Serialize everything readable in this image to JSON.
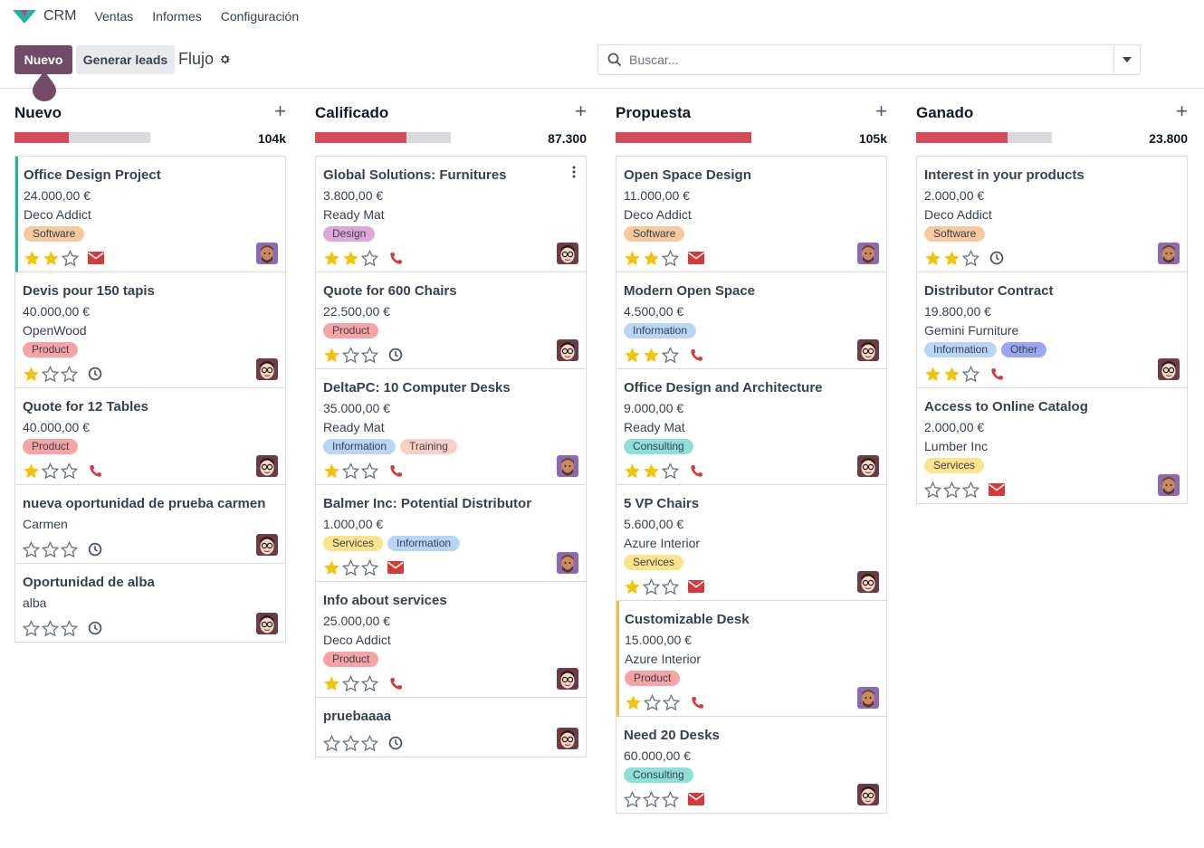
{
  "navbar": {
    "app_name": "CRM",
    "menu": [
      "Ventas",
      "Informes",
      "Configuración"
    ]
  },
  "control": {
    "new_label": "Nuevo",
    "generate_label": "Generar leads",
    "breadcrumb": "Flujo",
    "search_placeholder": "Buscar..."
  },
  "colors": {
    "primary": "#714b67",
    "progress_red": "#d44c59",
    "star_gold": "#f3c30b",
    "email_red": "#d43a3a"
  },
  "columns": [
    {
      "title": "Nuevo",
      "total": "104k",
      "progress": 0.4,
      "cards": [
        {
          "title": "Office Design Project",
          "amount": "24.000,00 €",
          "partner": "Deco Addict",
          "tags": [
            "Software"
          ],
          "stars": 2,
          "activity": "email-icon",
          "avatar": "avatar-brown",
          "accent": "green"
        },
        {
          "title": "Devis pour 150 tapis",
          "amount": "40.000,00 €",
          "partner": "OpenWood",
          "tags": [
            "Product"
          ],
          "stars": 1,
          "activity": "clock-icon",
          "avatar": "avatar-glasses"
        },
        {
          "title": "Quote for 12 Tables",
          "amount": "40.000,00 €",
          "partner": "",
          "tags": [
            "Product"
          ],
          "stars": 1,
          "activity": "phone-icon",
          "avatar": "avatar-glasses"
        },
        {
          "title": "nueva oportunidad de prueba carmen",
          "amount": "",
          "partner": "Carmen",
          "tags": [],
          "stars": 0,
          "activity": "clock-icon",
          "avatar": "avatar-glasses"
        },
        {
          "title": "Oportunidad de alba",
          "amount": "",
          "partner": "alba",
          "tags": [],
          "stars": 0,
          "activity": "clock-icon",
          "avatar": "avatar-glasses"
        }
      ]
    },
    {
      "title": "Calificado",
      "total": "87.300",
      "progress": 0.67,
      "cards": [
        {
          "title": "Global Solutions: Furnitures",
          "amount": "3.800,00 €",
          "partner": "Ready Mat",
          "tags": [
            "Design"
          ],
          "stars": 2,
          "activity": "phone-icon",
          "avatar": "avatar-glasses",
          "kebab": true
        },
        {
          "title": "Quote for 600 Chairs",
          "amount": "22.500,00 €",
          "partner": "",
          "tags": [
            "Product"
          ],
          "stars": 1,
          "activity": "clock-icon",
          "avatar": "avatar-glasses"
        },
        {
          "title": "DeltaPC: 10 Computer Desks",
          "amount": "35.000,00 €",
          "partner": "Ready Mat",
          "tags": [
            "Information",
            "Training"
          ],
          "stars": 1,
          "activity": "phone-icon",
          "avatar": "avatar-brown"
        },
        {
          "title": "Balmer Inc: Potential Distributor",
          "amount": "1.000,00 €",
          "partner": "",
          "tags": [
            "Services",
            "Information"
          ],
          "stars": 1,
          "activity": "email-icon",
          "avatar": "avatar-brown"
        },
        {
          "title": "Info about services",
          "amount": "25.000,00 €",
          "partner": "Deco Addict",
          "tags": [
            "Product"
          ],
          "stars": 1,
          "activity": "phone-icon",
          "avatar": "avatar-glasses"
        },
        {
          "title": "pruebaaaa",
          "amount": "",
          "partner": "",
          "tags": [],
          "stars": 0,
          "activity": "clock-icon",
          "avatar": "avatar-glasses"
        }
      ]
    },
    {
      "title": "Propuesta",
      "total": "105k",
      "progress": 1.0,
      "cards": [
        {
          "title": "Open Space Design",
          "amount": "11.000,00 €",
          "partner": "Deco Addict",
          "tags": [
            "Software"
          ],
          "stars": 2,
          "activity": "email-icon",
          "avatar": "avatar-brown"
        },
        {
          "title": "Modern Open Space",
          "amount": "4.500,00 €",
          "partner": "",
          "tags": [
            "Information"
          ],
          "stars": 2,
          "activity": "phone-icon",
          "avatar": "avatar-glasses"
        },
        {
          "title": "Office Design and Architecture",
          "amount": "9.000,00 €",
          "partner": "Ready Mat",
          "tags": [
            "Consulting"
          ],
          "stars": 2,
          "activity": "phone-icon",
          "avatar": "avatar-glasses"
        },
        {
          "title": "5 VP Chairs",
          "amount": "5.600,00 €",
          "partner": "Azure Interior",
          "tags": [
            "Services"
          ],
          "stars": 1,
          "activity": "email-icon",
          "avatar": "avatar-glasses"
        },
        {
          "title": "Customizable Desk",
          "amount": "15.000,00 €",
          "partner": "Azure Interior",
          "tags": [
            "Product"
          ],
          "stars": 1,
          "activity": "phone-icon",
          "avatar": "avatar-brown",
          "accent": "yellow"
        },
        {
          "title": "Need 20 Desks",
          "amount": "60.000,00 €",
          "partner": "",
          "tags": [
            "Consulting"
          ],
          "stars": 0,
          "activity": "email-icon",
          "avatar": "avatar-glasses"
        }
      ]
    },
    {
      "title": "Ganado",
      "total": "23.800",
      "progress": 0.67,
      "cards": [
        {
          "title": "Interest in your products",
          "amount": "2.000,00 €",
          "partner": "Deco Addict",
          "tags": [
            "Software"
          ],
          "stars": 2,
          "activity": "clock-icon",
          "avatar": "avatar-brown"
        },
        {
          "title": "Distributor Contract",
          "amount": "19.800,00 €",
          "partner": "Gemini Furniture",
          "tags": [
            "Information",
            "Other"
          ],
          "stars": 2,
          "activity": "phone-icon",
          "avatar": "avatar-glasses"
        },
        {
          "title": "Access to Online Catalog",
          "amount": "2.000,00 €",
          "partner": "Lumber Inc",
          "tags": [
            "Services"
          ],
          "stars": 0,
          "activity": "email-icon",
          "avatar": "avatar-brown"
        }
      ]
    }
  ],
  "tag_colors": {
    "Software": "#f7c99c",
    "Product": "#f7a3a3",
    "Design": "#dda8d8",
    "Information": "#b8d5f7",
    "Training": "#f9d0c4",
    "Services": "#fbe38c",
    "Consulting": "#8ee0d6",
    "Other": "#9aa7f0"
  }
}
